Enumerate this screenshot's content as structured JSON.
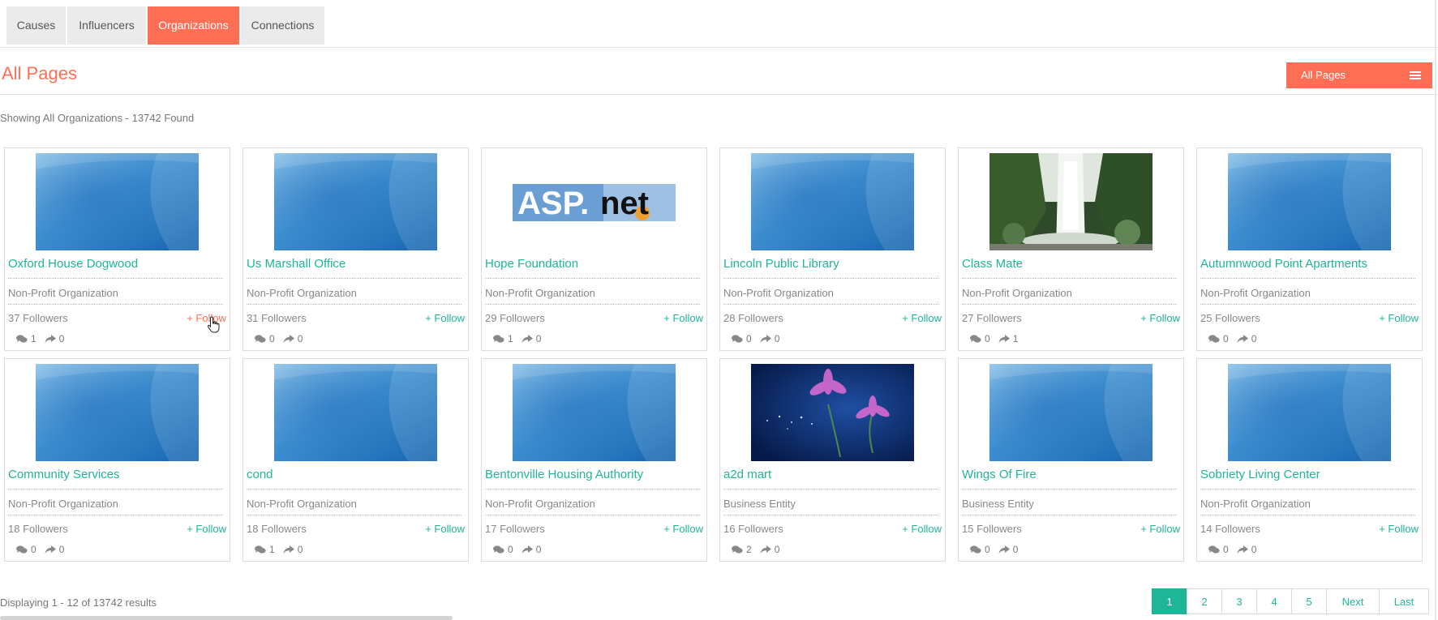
{
  "tabs": [
    {
      "label": "Causes"
    },
    {
      "label": "Influencers"
    },
    {
      "label": "Organizations"
    },
    {
      "label": "Connections"
    }
  ],
  "header": {
    "title": "All Pages",
    "dropdown_label": "All Pages",
    "showing_text": "Showing All Organizations - 13742 Found"
  },
  "colors": {
    "accent": "#ff6f55",
    "link": "#1fb597"
  },
  "follow_label": "+ Follow",
  "cards": [
    {
      "name": "Oxford House Dogwood",
      "type": "Non-Profit Organization",
      "followers": "37 Followers",
      "comments": "1",
      "shares": "0",
      "image": "blue-placeholder"
    },
    {
      "name": "Us Marshall Office",
      "type": "Non-Profit Organization",
      "followers": "31 Followers",
      "comments": "0",
      "shares": "0",
      "image": "blue-placeholder"
    },
    {
      "name": "Hope Foundation",
      "type": "Non-Profit Organization",
      "followers": "29 Followers",
      "comments": "1",
      "shares": "0",
      "image": "aspnet-logo",
      "logo_text": "ASP.net"
    },
    {
      "name": "Lincoln Public Library",
      "type": "Non-Profit Organization",
      "followers": "28 Followers",
      "comments": "0",
      "shares": "0",
      "image": "blue-placeholder"
    },
    {
      "name": "Class Mate",
      "type": "Non-Profit Organization",
      "followers": "27 Followers",
      "comments": "0",
      "shares": "1",
      "image": "waterfall"
    },
    {
      "name": "Autumnwood Point Apartments",
      "type": "Non-Profit Organization",
      "followers": "25 Followers",
      "comments": "0",
      "shares": "0",
      "image": "blue-placeholder"
    },
    {
      "name": "Community Services",
      "type": "Non-Profit Organization",
      "followers": "18 Followers",
      "comments": "0",
      "shares": "0",
      "image": "blue-placeholder"
    },
    {
      "name": "cond",
      "type": "Non-Profit Organization",
      "followers": "18 Followers",
      "comments": "1",
      "shares": "0",
      "image": "blue-placeholder"
    },
    {
      "name": "Bentonville Housing Authority",
      "type": "Non-Profit Organization",
      "followers": "17 Followers",
      "comments": "0",
      "shares": "0",
      "image": "blue-placeholder"
    },
    {
      "name": "a2d mart",
      "type": "Business Entity",
      "followers": "16 Followers",
      "comments": "2",
      "shares": "0",
      "image": "flowers"
    },
    {
      "name": "Wings Of Fire",
      "type": "Business Entity",
      "followers": "15 Followers",
      "comments": "0",
      "shares": "0",
      "image": "blue-placeholder"
    },
    {
      "name": "Sobriety Living Center",
      "type": "Non-Profit Organization",
      "followers": "14 Followers",
      "comments": "0",
      "shares": "0",
      "image": "blue-placeholder"
    }
  ],
  "footer": {
    "displaying": "Displaying 1 - 12 of 13742 results",
    "pages": [
      "1",
      "2",
      "3",
      "4",
      "5",
      "Next",
      "Last"
    ],
    "active_page": "1"
  }
}
